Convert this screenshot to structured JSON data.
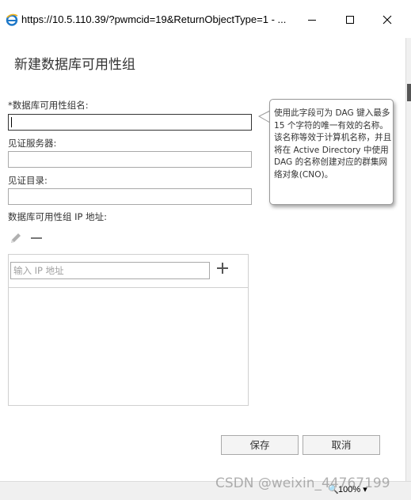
{
  "window": {
    "title": "https://10.5.110.39/?pwmcid=19&ReturnObjectType=1 - ...",
    "icons": [
      "ie-icon",
      "minimize-icon",
      "maximize-icon",
      "close-icon"
    ]
  },
  "dialog": {
    "title": "新建数据库可用性组",
    "dag_name_label": "*数据库可用性组名:",
    "dag_name_value": "",
    "witness_server_label": "见证服务器:",
    "witness_server_value": "",
    "witness_dir_label": "见证目录:",
    "witness_dir_value": "",
    "ip_section_label": "数据库可用性组 IP 地址:",
    "ip_input_placeholder": "输入 IP 地址",
    "ip_list": [],
    "save_label": "保存",
    "cancel_label": "取消"
  },
  "tooltip": {
    "text": "使用此字段可为 DAG 键入最多 15 个字符的唯一有效的名称。该名称等效于计算机名称，并且将在 Active Directory 中使用 DAG 的名称创建对应的群集网络对象(CNO)。"
  },
  "statusbar": {
    "zoom": "100%"
  },
  "watermark": "CSDN @weixin_44767199",
  "colors": {
    "text": "#333333",
    "border": "#a9a9a9",
    "panel_border": "#d0d0d0",
    "icon_gray": "#777777",
    "ie_blue": "#1e78c8"
  }
}
